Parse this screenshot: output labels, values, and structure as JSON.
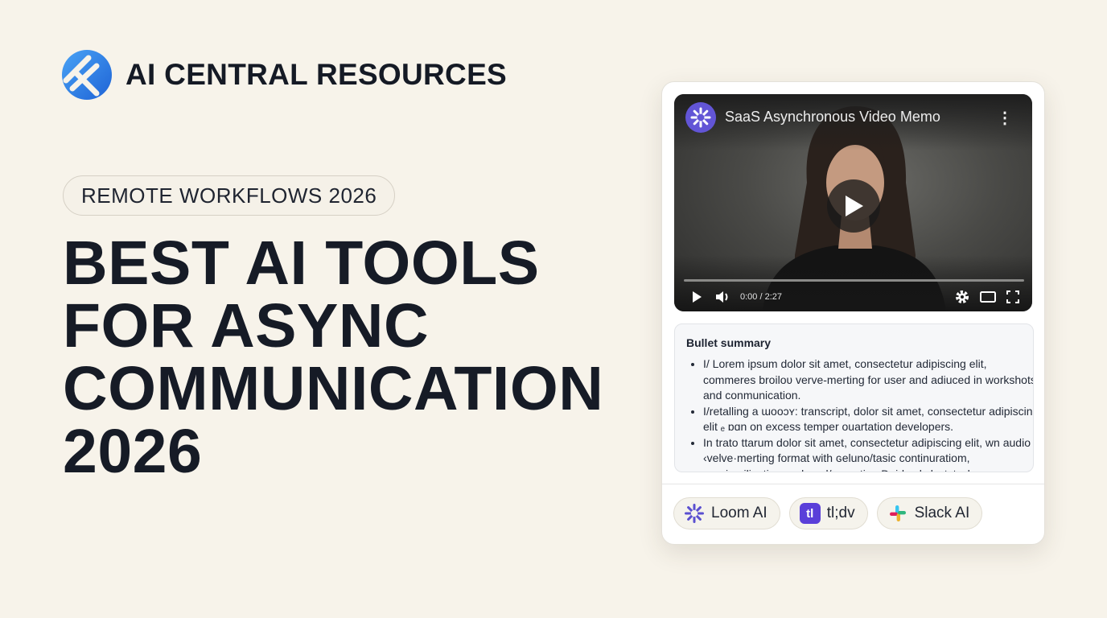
{
  "brand": {
    "name": "AI CENTRAL RESOURCES",
    "logo_icon": "blue-diamond-logo-icon"
  },
  "tag": "REMOTE WORKFLOWS 2026",
  "headline": {
    "lines": [
      "BEST AI TOOLS",
      "FOR ASYNC",
      "COMMUNICATION",
      "2026"
    ]
  },
  "video": {
    "title": "SaaS Asynchronous Video Memo",
    "time": "0:00 / 2:27",
    "progress": 0,
    "icons": [
      "loom-logo-icon",
      "more-vertical-icon",
      "play-icon",
      "volume-icon",
      "settings-icon",
      "theater-mode-icon",
      "fullscreen-icon"
    ]
  },
  "summary": {
    "title": "Bullet summary",
    "items": [
      "I/ Lorem ipsum dolor sit amet, consectetur adipiscing elit, commeres broiloʋ verve-merting for user and adiuced in workshots and conmunication.",
      "I/retalling a ɯooɔʏ: transcript, dolor sit amet, consectetur adipiscing elit ₑ ɒɑn on excess temper ouartation developers.",
      "In trato ttarum dolor sit amet, consectetur adipiscing elit, wn audio ‹velve·merting format with ɢeluno/tasic continuratiom, ɔɔɔɔimailiɔɑtion ɔɔɔkor ɔl/unɪɔation Doidɔ al ɔlɔɔtɔtɔɔh"
    ]
  },
  "chips": [
    {
      "label": "Loom AI",
      "icon": "loom-logo-icon"
    },
    {
      "label": "tl;dv",
      "icon": "tldv-logo-icon",
      "icon_text": "tl"
    },
    {
      "label": "Slack AI",
      "icon": "slack-logo-icon"
    }
  ],
  "colors": {
    "background": "#f7f3ea",
    "headline": "#161b26",
    "brand_blue": "#2f7de1",
    "loom_purple": "#6255d6",
    "tldv_purple": "#5a3fd9"
  }
}
